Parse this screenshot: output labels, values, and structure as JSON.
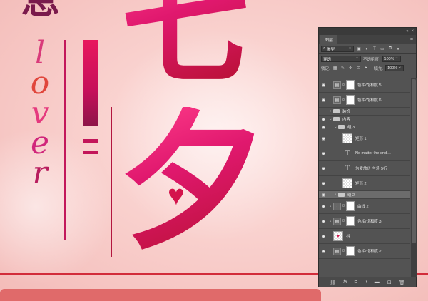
{
  "poster": {
    "top_clipped_char": "息",
    "vertical_word": [
      "l",
      "o",
      "v",
      "e",
      "r"
    ],
    "vertical_word_colors": [
      "#d93a7a",
      "#e0463c",
      "#e5397e",
      "#d0267b",
      "#b81d5e"
    ],
    "big_char_1": "七",
    "big_char_2": "夕",
    "heart": "♥",
    "accent_color": "#e0186e"
  },
  "ps_panel": {
    "tab_title": "图层",
    "filter_kind": "类型",
    "blend_mode": "穿透",
    "opacity_label": "不透明度:",
    "opacity_value": "100%",
    "lock_label": "锁定:",
    "fill_label": "填充:",
    "fill_value": "100%",
    "layers": [
      {
        "name": "色相/饱和度 5",
        "kind": "adjustment",
        "visible": true
      },
      {
        "name": "色相/饱和度 6",
        "kind": "adjustment",
        "visible": true
      },
      {
        "name": "装饰",
        "kind": "group-closed",
        "visible": false
      },
      {
        "name": "内容",
        "kind": "group-open",
        "visible": true
      },
      {
        "name": "组 3",
        "kind": "group-open",
        "visible": true
      },
      {
        "name": "矩形 1",
        "kind": "shape",
        "visible": true
      },
      {
        "name": "No matter the endi...",
        "kind": "text",
        "visible": true
      },
      {
        "name": "为爱放价 全场 5折",
        "kind": "text",
        "visible": true
      },
      {
        "name": "矩形 2",
        "kind": "shape",
        "visible": true
      },
      {
        "name": "组 2",
        "kind": "group-closed",
        "visible": true,
        "selected": true
      },
      {
        "name": "曲线 2",
        "kind": "curves",
        "visible": true
      },
      {
        "name": "色相/饱和度 3",
        "kind": "adjustment",
        "visible": true
      },
      {
        "name": "抖",
        "kind": "image",
        "visible": true
      },
      {
        "name": "色相/饱和度 2",
        "kind": "adjustment",
        "visible": true
      }
    ],
    "footer_icons": [
      "link-icon",
      "fx-icon",
      "mask-icon",
      "adjustment-icon",
      "folder-icon",
      "new-layer-icon",
      "trash-icon"
    ]
  }
}
